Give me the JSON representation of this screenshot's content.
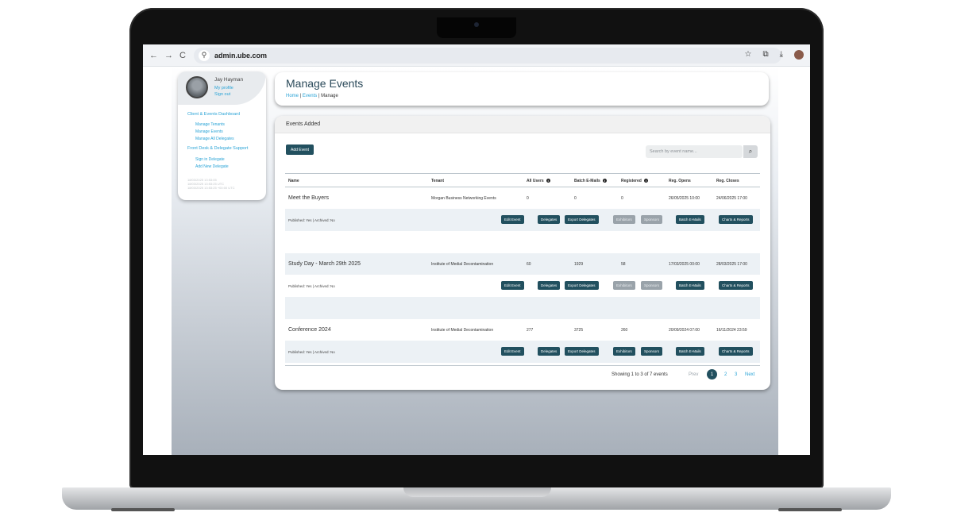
{
  "browser": {
    "nav_back": "←",
    "nav_forward": "→",
    "reload": "C",
    "url": "admin.ube.com"
  },
  "sidebar": {
    "user_name": "Jay Hayman",
    "my_profile": "My profile",
    "sign_out": "Sign out",
    "section1": "Client & Events Dashboard",
    "section1_items": [
      "Manage Tenants",
      "Manage Events",
      "Manage All Delegates"
    ],
    "section2": "Front Desk & Delegate Support",
    "section2_items": [
      "Sign in Delegate",
      "Add New Delegate"
    ],
    "stamps": [
      "18/03/2025 13:53:05",
      "18/03/2025 13:53:25 UTC",
      "18/03/2025 13:53:25 +00:00 UTC"
    ]
  },
  "header": {
    "title": "Manage Events",
    "breadcrumb_home": "Home",
    "breadcrumb_events": "Events",
    "breadcrumb_current": "Manage"
  },
  "events_panel": {
    "title": "Events Added",
    "add_button": "Add Event",
    "search_placeholder": "Search by event name...",
    "columns": [
      "Name",
      "Tenant",
      "All Users",
      "Batch E-Mails",
      "Registered",
      "Reg. Opens",
      "Reg. Closes"
    ],
    "info_icon": "i",
    "rows": [
      {
        "name": "Meet the Buyers",
        "tenant": "Morgan Business Networking Events",
        "all_users": "0",
        "batch_emails": "0",
        "registered": "0",
        "reg_opens": "26/05/2025 10:00",
        "reg_closes": "24/06/2025 17:00",
        "status": "Published: Yes | Archived: No",
        "exhibitors_enabled": false,
        "sponsors_enabled": false
      },
      {
        "name": "Study Day - March 29th 2025",
        "tenant": "Institute of Medial Decontamination",
        "all_users": "60",
        "batch_emails": "1929",
        "registered": "58",
        "reg_opens": "17/03/2025 00:00",
        "reg_closes": "28/03/2025 17:00",
        "status": "Published: Yes | Archived: No",
        "exhibitors_enabled": false,
        "sponsors_enabled": false
      },
      {
        "name": "Conference 2024",
        "tenant": "Institute of Medial Decontamination",
        "all_users": "277",
        "batch_emails": "3725",
        "registered": "260",
        "reg_opens": "20/09/2024 07:00",
        "reg_closes": "16/11/2024 23:59",
        "status": "Published: Yes | Archived: No",
        "exhibitors_enabled": true,
        "sponsors_enabled": true
      }
    ],
    "row_buttons": {
      "edit": "Edit Event",
      "delegates": "Delegates",
      "export": "Export Delegates",
      "exhibitors": "Exhibitors",
      "sponsors": "Sponsors",
      "batch": "Batch E-Mails",
      "charts": "Charts & Reports"
    },
    "showing_text": "Showing 1 to 3 of 7 events",
    "pagination": {
      "prev": "Prev",
      "pages": [
        "1",
        "2",
        "3"
      ],
      "current": "1",
      "next": "Next"
    }
  },
  "colors": {
    "accent": "#22505f",
    "link": "#29a3d6",
    "disabled": "#9aa3aa"
  }
}
